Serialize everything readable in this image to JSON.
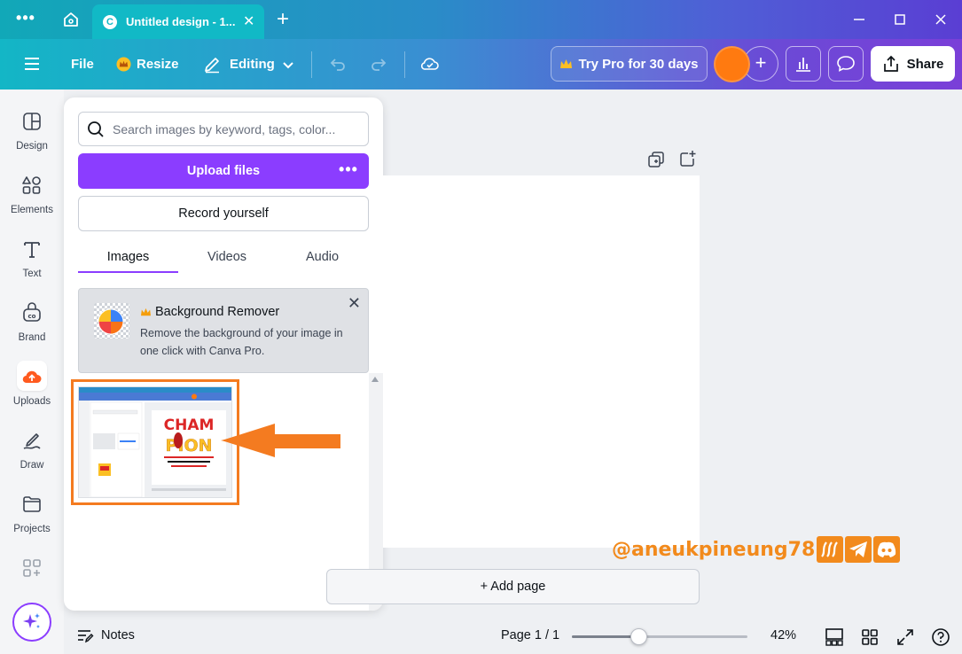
{
  "window": {
    "tab_title": "Untitled design - 1...",
    "tab_logo": "C",
    "more_icon": "more-dots-icon"
  },
  "toolbar": {
    "file_label": "File",
    "resize_label": "Resize",
    "editing_label": "Editing",
    "try_pro_label": "Try Pro for 30 days",
    "share_label": "Share"
  },
  "rail": {
    "items": [
      {
        "label": "Design",
        "icon": "design-icon"
      },
      {
        "label": "Elements",
        "icon": "elements-icon"
      },
      {
        "label": "Text",
        "icon": "text-icon"
      },
      {
        "label": "Brand",
        "icon": "brand-icon"
      },
      {
        "label": "Uploads",
        "icon": "upload-cloud-icon"
      },
      {
        "label": "Draw",
        "icon": "draw-icon"
      },
      {
        "label": "Projects",
        "icon": "folder-icon"
      }
    ]
  },
  "panel": {
    "search_placeholder": "Search images by keyword, tags, color...",
    "upload_label": "Upload files",
    "record_label": "Record yourself",
    "tabs": [
      "Images",
      "Videos",
      "Audio"
    ],
    "active_tab": "Images",
    "promo": {
      "title": "Background Remover",
      "description": "Remove the background of your image in one click with Canva Pro."
    },
    "thumbnail": {
      "headline_top": "CHAM",
      "headline_bottom": "PION"
    }
  },
  "canvas": {
    "add_page_label": "+ Add page"
  },
  "watermark": {
    "text": "@aneukpineung78"
  },
  "bottombar": {
    "notes_label": "Notes",
    "page_info": "Page 1 / 1",
    "zoom_label": "42%",
    "zoom_fraction": 0.42
  },
  "colors": {
    "accent": "#8b3dff",
    "highlight": "#f47b20",
    "avatar": "#ff7a10"
  }
}
